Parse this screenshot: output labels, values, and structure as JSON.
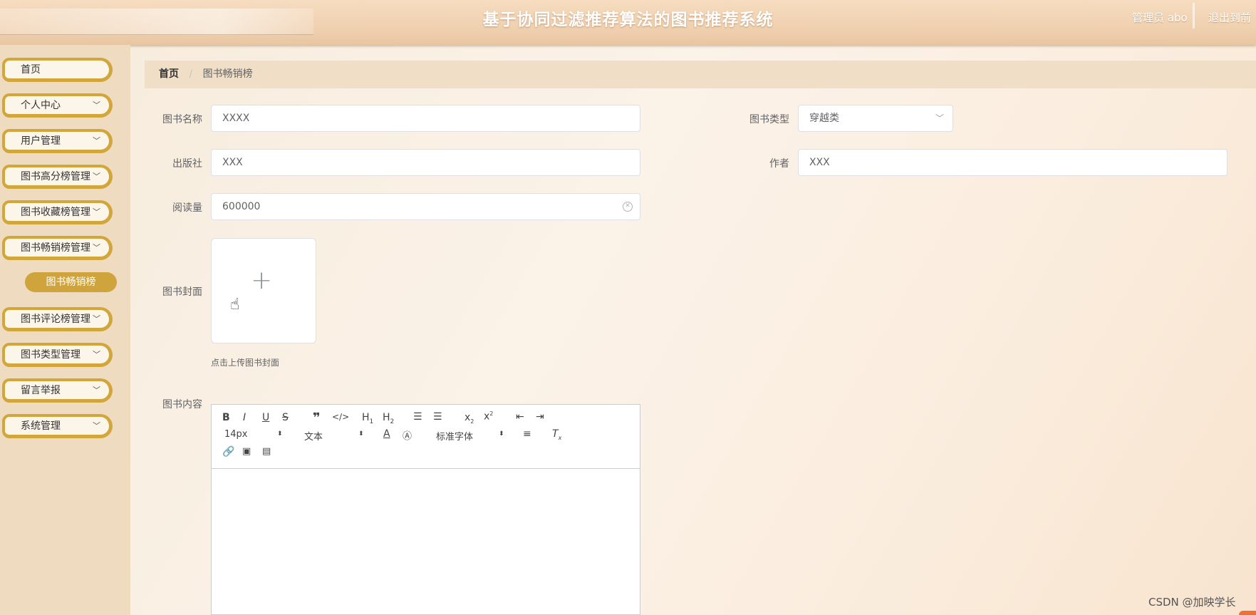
{
  "header": {
    "title": "基于协同过滤推荐算法的图书推荐系统",
    "user": "管理员 abo",
    "logout": "退出到前"
  },
  "sidebar": {
    "items": [
      {
        "label": "首页"
      },
      {
        "label": "个人中心"
      },
      {
        "label": "用户管理"
      },
      {
        "label": "图书高分榜管理"
      },
      {
        "label": "图书收藏榜管理"
      },
      {
        "label": "图书畅销榜管理"
      },
      {
        "label": "图书评论榜管理"
      },
      {
        "label": "图书类型管理"
      },
      {
        "label": "留言举报"
      },
      {
        "label": "系统管理"
      }
    ],
    "active_sub": "图书畅销榜"
  },
  "breadcrumb": {
    "home": "首页",
    "separator": "/",
    "current": "图书畅销榜"
  },
  "form": {
    "name_label": "图书名称",
    "name_value": "XXXX",
    "type_label": "图书类型",
    "type_value": "穿越类",
    "publisher_label": "出版社",
    "publisher_value": "XXX",
    "author_label": "作者",
    "author_value": "XXX",
    "reads_label": "阅读量",
    "reads_value": "600000",
    "cover_label": "图书封面",
    "cover_tip": "点击上传图书封面",
    "content_label": "图书内容"
  },
  "editor": {
    "font_size": "14px",
    "header_select": "文本",
    "font_family": "标准字体"
  },
  "watermark": "CSDN @加映学长"
}
